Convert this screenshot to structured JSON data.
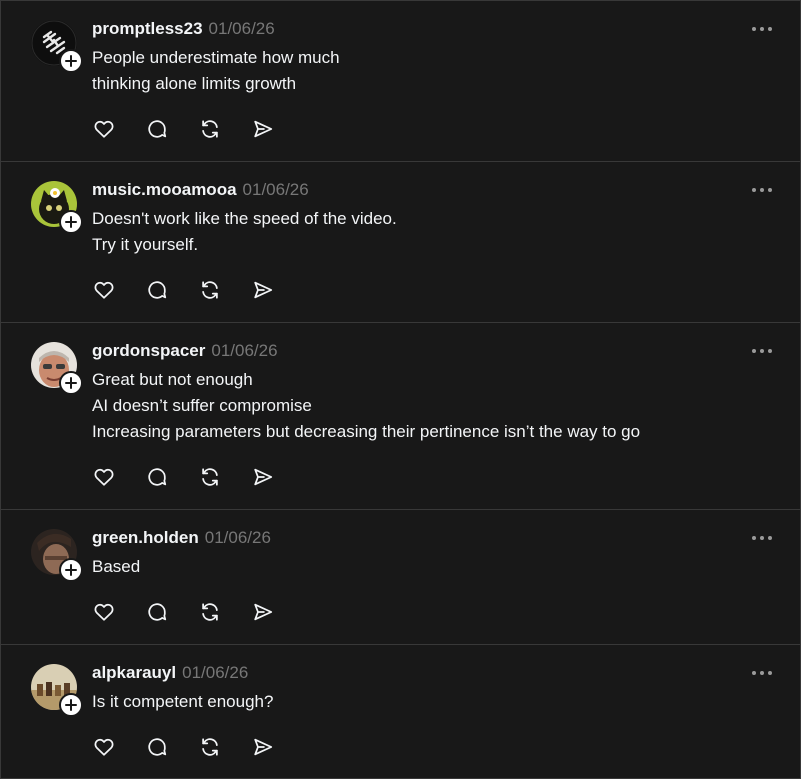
{
  "posts": [
    {
      "username": "promptless23",
      "date": "01/06/26",
      "lines": [
        "People underestimate how much",
        "thinking alone limits growth"
      ],
      "avatar_icon": "promptless-logo-avatar"
    },
    {
      "username": "music.mooamooa",
      "date": "01/06/26",
      "lines": [
        "Doesn't work like the speed of the video.",
        "Try it yourself."
      ],
      "avatar_icon": "cat-with-flower-avatar"
    },
    {
      "username": "gordonspacer",
      "date": "01/06/26",
      "lines": [
        "Great but not enough",
        "AI doesn’t suffer compromise",
        "Increasing parameters but decreasing their pertinence isn’t the way to go"
      ],
      "avatar_icon": "man-with-glasses-avatar"
    },
    {
      "username": "green.holden",
      "date": "01/06/26",
      "lines": [
        "Based"
      ],
      "avatar_icon": "person-photo-avatar"
    },
    {
      "username": "alpkarauyl",
      "date": "01/06/26",
      "lines": [
        "Is it competent enough?"
      ],
      "avatar_icon": "horses-photo-avatar"
    }
  ],
  "icons": {
    "like": "heart-icon",
    "reply": "comment-icon",
    "repost": "repost-icon",
    "share": "send-icon",
    "more": "more-options-icon",
    "follow": "plus-icon"
  },
  "colors": {
    "background": "#181818",
    "divider": "#383838",
    "text": "#f3f5f7",
    "muted": "#777777"
  }
}
